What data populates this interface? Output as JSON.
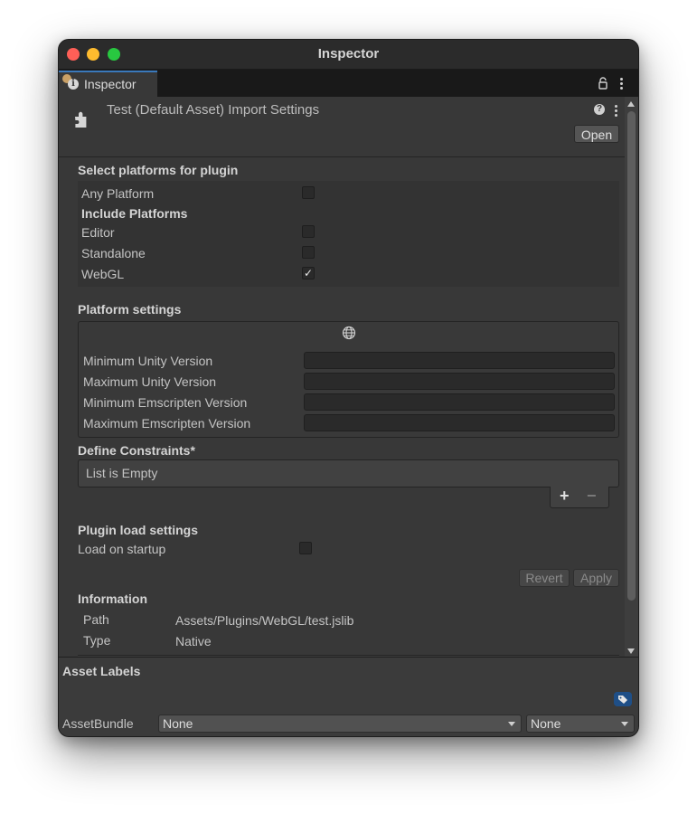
{
  "window": {
    "title": "Inspector"
  },
  "tab": {
    "label": "Inspector"
  },
  "header": {
    "title": "Test (Default Asset) Import Settings",
    "open_label": "Open"
  },
  "platforms": {
    "title": "Select platforms for plugin",
    "any_platform": {
      "label": "Any Platform",
      "checked": false
    },
    "include_title": "Include Platforms",
    "items": [
      {
        "label": "Editor",
        "checked": false,
        "mark": ""
      },
      {
        "label": "Standalone",
        "checked": false,
        "mark": ""
      },
      {
        "label": "WebGL",
        "checked": true,
        "mark": "✓"
      }
    ]
  },
  "platform_settings": {
    "title": "Platform settings",
    "fields": [
      {
        "label": "Minimum Unity Version",
        "value": ""
      },
      {
        "label": "Maximum Unity Version",
        "value": ""
      },
      {
        "label": "Minimum Emscripten Version",
        "value": ""
      },
      {
        "label": "Maximum Emscripten Version",
        "value": ""
      }
    ]
  },
  "constraints": {
    "title": "Define Constraints*",
    "empty_text": "List is Empty",
    "add": "+",
    "remove": "−"
  },
  "load_settings": {
    "title": "Plugin load settings",
    "load_on_startup": {
      "label": "Load on startup",
      "checked": false
    }
  },
  "actions": {
    "revert": "Revert",
    "apply": "Apply"
  },
  "information": {
    "title": "Information",
    "rows": [
      {
        "key": "Path",
        "value": "Assets/Plugins/WebGL/test.jslib"
      },
      {
        "key": "Type",
        "value": "Native"
      }
    ]
  },
  "asset_labels": {
    "title": "Asset Labels"
  },
  "asset_bundle": {
    "label": "AssetBundle",
    "name": "None",
    "variant": "None"
  },
  "colors": {
    "accent": "#3a79bb",
    "background": "#383838",
    "tag": "#1f4f87"
  },
  "icons": [
    "info-icon",
    "lock-icon",
    "menu-dots-icon",
    "plugin-icon",
    "help-icon",
    "globe-icon",
    "tag-icon",
    "chevron-down-icon"
  ]
}
